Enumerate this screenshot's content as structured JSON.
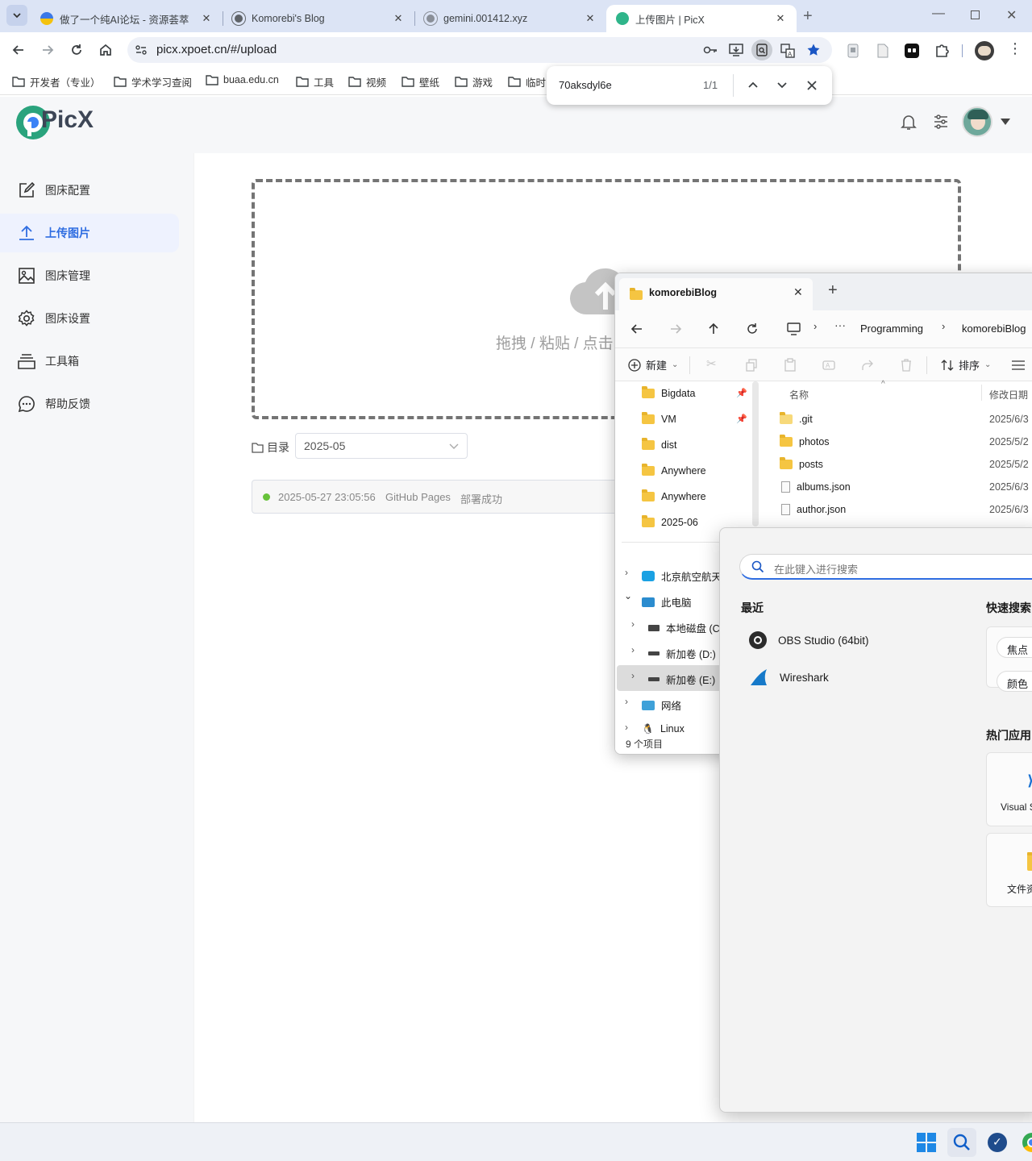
{
  "browser": {
    "tabs": [
      {
        "title": "做了一个纯AI论坛 - 资源荟萃",
        "active": false
      },
      {
        "title": "Komorebi's Blog",
        "active": false
      },
      {
        "title": "gemini.001412.xyz",
        "active": false
      },
      {
        "title": "上传图片 | PicX",
        "active": true
      }
    ],
    "url": "picx.xpoet.cn/#/upload",
    "bookmarks": [
      "开发者（专业）",
      "学术学习查阅",
      "buaa.edu.cn",
      "工具",
      "视频",
      "壁纸",
      "游戏",
      "临时"
    ],
    "find": {
      "query": "70aksdyl6e",
      "count": "1/1"
    }
  },
  "app": {
    "name": "PicX",
    "nav": [
      {
        "label": "图床配置",
        "icon": "edit-icon",
        "active": false
      },
      {
        "label": "上传图片",
        "icon": "upload-icon",
        "active": true
      },
      {
        "label": "图床管理",
        "icon": "image-icon",
        "active": false
      },
      {
        "label": "图床设置",
        "icon": "gear-icon",
        "active": false
      },
      {
        "label": "工具箱",
        "icon": "toolbox-icon",
        "active": false
      },
      {
        "label": "帮助反馈",
        "icon": "feedback-icon",
        "active": false
      }
    ],
    "drop_text": "拖拽 / 粘贴 / 点击",
    "dir_label": "目录",
    "dir_value": "2025-05",
    "status": {
      "time": "2025-05-27 23:05:56",
      "service": "GitHub Pages",
      "message": "部署成功",
      "color": "#67c23a"
    },
    "accent": "#2f6de1"
  },
  "explorer": {
    "tab_title": "komorebiBlog",
    "breadcrumb": [
      "Programming",
      "komorebiBlog"
    ],
    "new_label": "新建",
    "sort_label": "排序",
    "nav_quick": [
      {
        "label": "Bigdata",
        "pinned": true
      },
      {
        "label": "VM",
        "pinned": true
      },
      {
        "label": "dist",
        "pinned": false
      },
      {
        "label": "Anywhere",
        "pinned": false
      },
      {
        "label": "Anywhere",
        "pinned": false
      },
      {
        "label": "2025-06",
        "pinned": false
      }
    ],
    "nav_tree": [
      {
        "label": "北京航空航天大",
        "icon": "cloud-icon",
        "indent": 0
      },
      {
        "label": "此电脑",
        "icon": "pc-icon",
        "indent": 0,
        "expanded": true
      },
      {
        "label": "本地磁盘 (C:",
        "icon": "drive-icon",
        "indent": 1
      },
      {
        "label": "新加卷 (D:)",
        "icon": "drive-icon",
        "indent": 1
      },
      {
        "label": "新加卷 (E:)",
        "icon": "drive-icon",
        "indent": 1,
        "selected": true
      },
      {
        "label": "网络",
        "icon": "network-icon",
        "indent": 0
      },
      {
        "label": "Linux",
        "icon": "linux-icon",
        "indent": 0
      }
    ],
    "columns": {
      "name": "名称",
      "modified": "修改日期"
    },
    "files": [
      {
        "name": ".git",
        "type": "folder",
        "date": "2025/6/3"
      },
      {
        "name": "photos",
        "type": "folder",
        "date": "2025/5/2"
      },
      {
        "name": "posts",
        "type": "folder",
        "date": "2025/5/2"
      },
      {
        "name": "albums.json",
        "type": "file",
        "date": "2025/6/3"
      },
      {
        "name": "author.json",
        "type": "file",
        "date": "2025/6/3"
      }
    ],
    "status": "9 个项目"
  },
  "startmenu": {
    "search_placeholder": "在此键入进行搜索",
    "recent_title": "最近",
    "recent": [
      {
        "name": "OBS Studio (64bit)",
        "icon": "obs-icon"
      },
      {
        "name": "Wireshark",
        "icon": "wireshark-icon"
      }
    ],
    "quick_title": "快速搜索",
    "quick_items": [
      "焦点",
      "颜色"
    ],
    "hot_title": "热门应用",
    "hot_apps": [
      "Visual S",
      "文件资"
    ]
  }
}
